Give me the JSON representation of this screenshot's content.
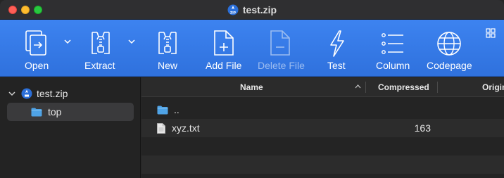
{
  "window": {
    "title": "test.zip"
  },
  "toolbar": {
    "open_label": "Open",
    "extract_label": "Extract",
    "new_label": "New",
    "add_file_label": "Add File",
    "delete_file_label": "Delete File",
    "test_label": "Test",
    "column_label": "Column",
    "codepage_label": "Codepage"
  },
  "sidebar": {
    "root": {
      "label": "test.zip",
      "expanded": true
    },
    "children": [
      {
        "label": "top",
        "selected": true
      }
    ]
  },
  "list": {
    "columns": [
      {
        "label": "Name",
        "sort": "ascending"
      },
      {
        "label": "Compressed"
      },
      {
        "label": "Origin"
      }
    ],
    "rows": [
      {
        "name": "..",
        "icon": "folder-icon",
        "compressed": ""
      },
      {
        "name": "xyz.txt",
        "icon": "document-icon",
        "compressed": "163"
      }
    ]
  },
  "colors": {
    "toolbar_blue": "#3579e8",
    "close": "#ff5f57",
    "minimize": "#febc2e",
    "maximize": "#28c840",
    "folder_blue": "#4fa3e6"
  }
}
